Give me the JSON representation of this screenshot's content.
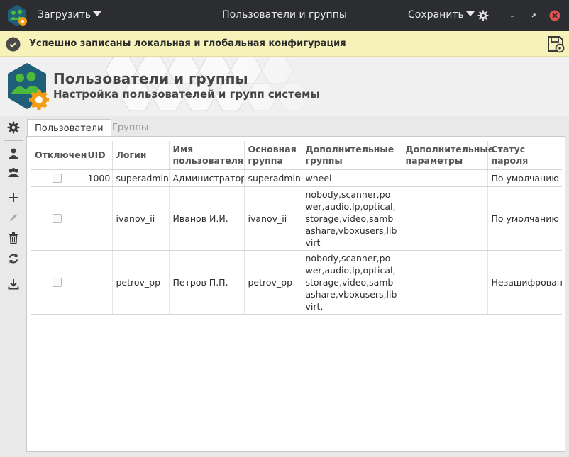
{
  "titlebar": {
    "load_label": "Загрузить",
    "title": "Пользователи и группы",
    "save_label": "Сохранить"
  },
  "notification": {
    "text": "Успешно записаны локальная и глобальная конфигурация",
    "bg_color": "#f6f2b9"
  },
  "header": {
    "title": "Пользователи и группы",
    "subtitle": "Настройка пользователей и групп системы",
    "accent_color": "#1f5f7a",
    "gear_color": "#f39c12",
    "people_color": "#4cbb3a"
  },
  "toolbar": {
    "buttons": [
      {
        "icon": "gear-icon"
      },
      {
        "icon": "user-icon"
      },
      {
        "icon": "group-icon"
      },
      {
        "icon": "plus-icon"
      },
      {
        "icon": "pencil-icon"
      },
      {
        "icon": "trash-icon"
      },
      {
        "icon": "refresh-icon"
      },
      {
        "icon": "download-icon"
      }
    ]
  },
  "tabs": [
    {
      "label": "Пользователи",
      "active": true
    },
    {
      "label": "Группы",
      "active": false
    }
  ],
  "table": {
    "columns": [
      "Отключен",
      "UID",
      "Логин",
      "Имя пользователя",
      "Основная группа",
      "Дополнительные группы",
      "Дополнительные параметры",
      "Статус пароля"
    ],
    "rows": [
      {
        "disabled": false,
        "uid": "1000",
        "login": "superadmin",
        "name": "Администратор",
        "primary_group": "superadmin",
        "groups": "wheel",
        "params": "",
        "password_status": "По умолчанию"
      },
      {
        "disabled": false,
        "uid": "",
        "login": "ivanov_ii",
        "name": "Иванов И.И.",
        "primary_group": "ivanov_ii",
        "groups": "nobody,scanner,pow­er,audio,lp,optical,st­orage,video,sambas­hare,vboxusers,libvirt",
        "params": "",
        "password_status": "По умолчанию"
      },
      {
        "disabled": false,
        "uid": "",
        "login": "petrov_pp",
        "name": "Петров П.П.",
        "primary_group": "petrov_pp",
        "groups": "nobody,scanner,pow­er,audio,lp,optical,st­orage,video,sambas­hare,vboxusers,libvirt,",
        "params": "",
        "password_status": "Незашифрован"
      }
    ]
  }
}
